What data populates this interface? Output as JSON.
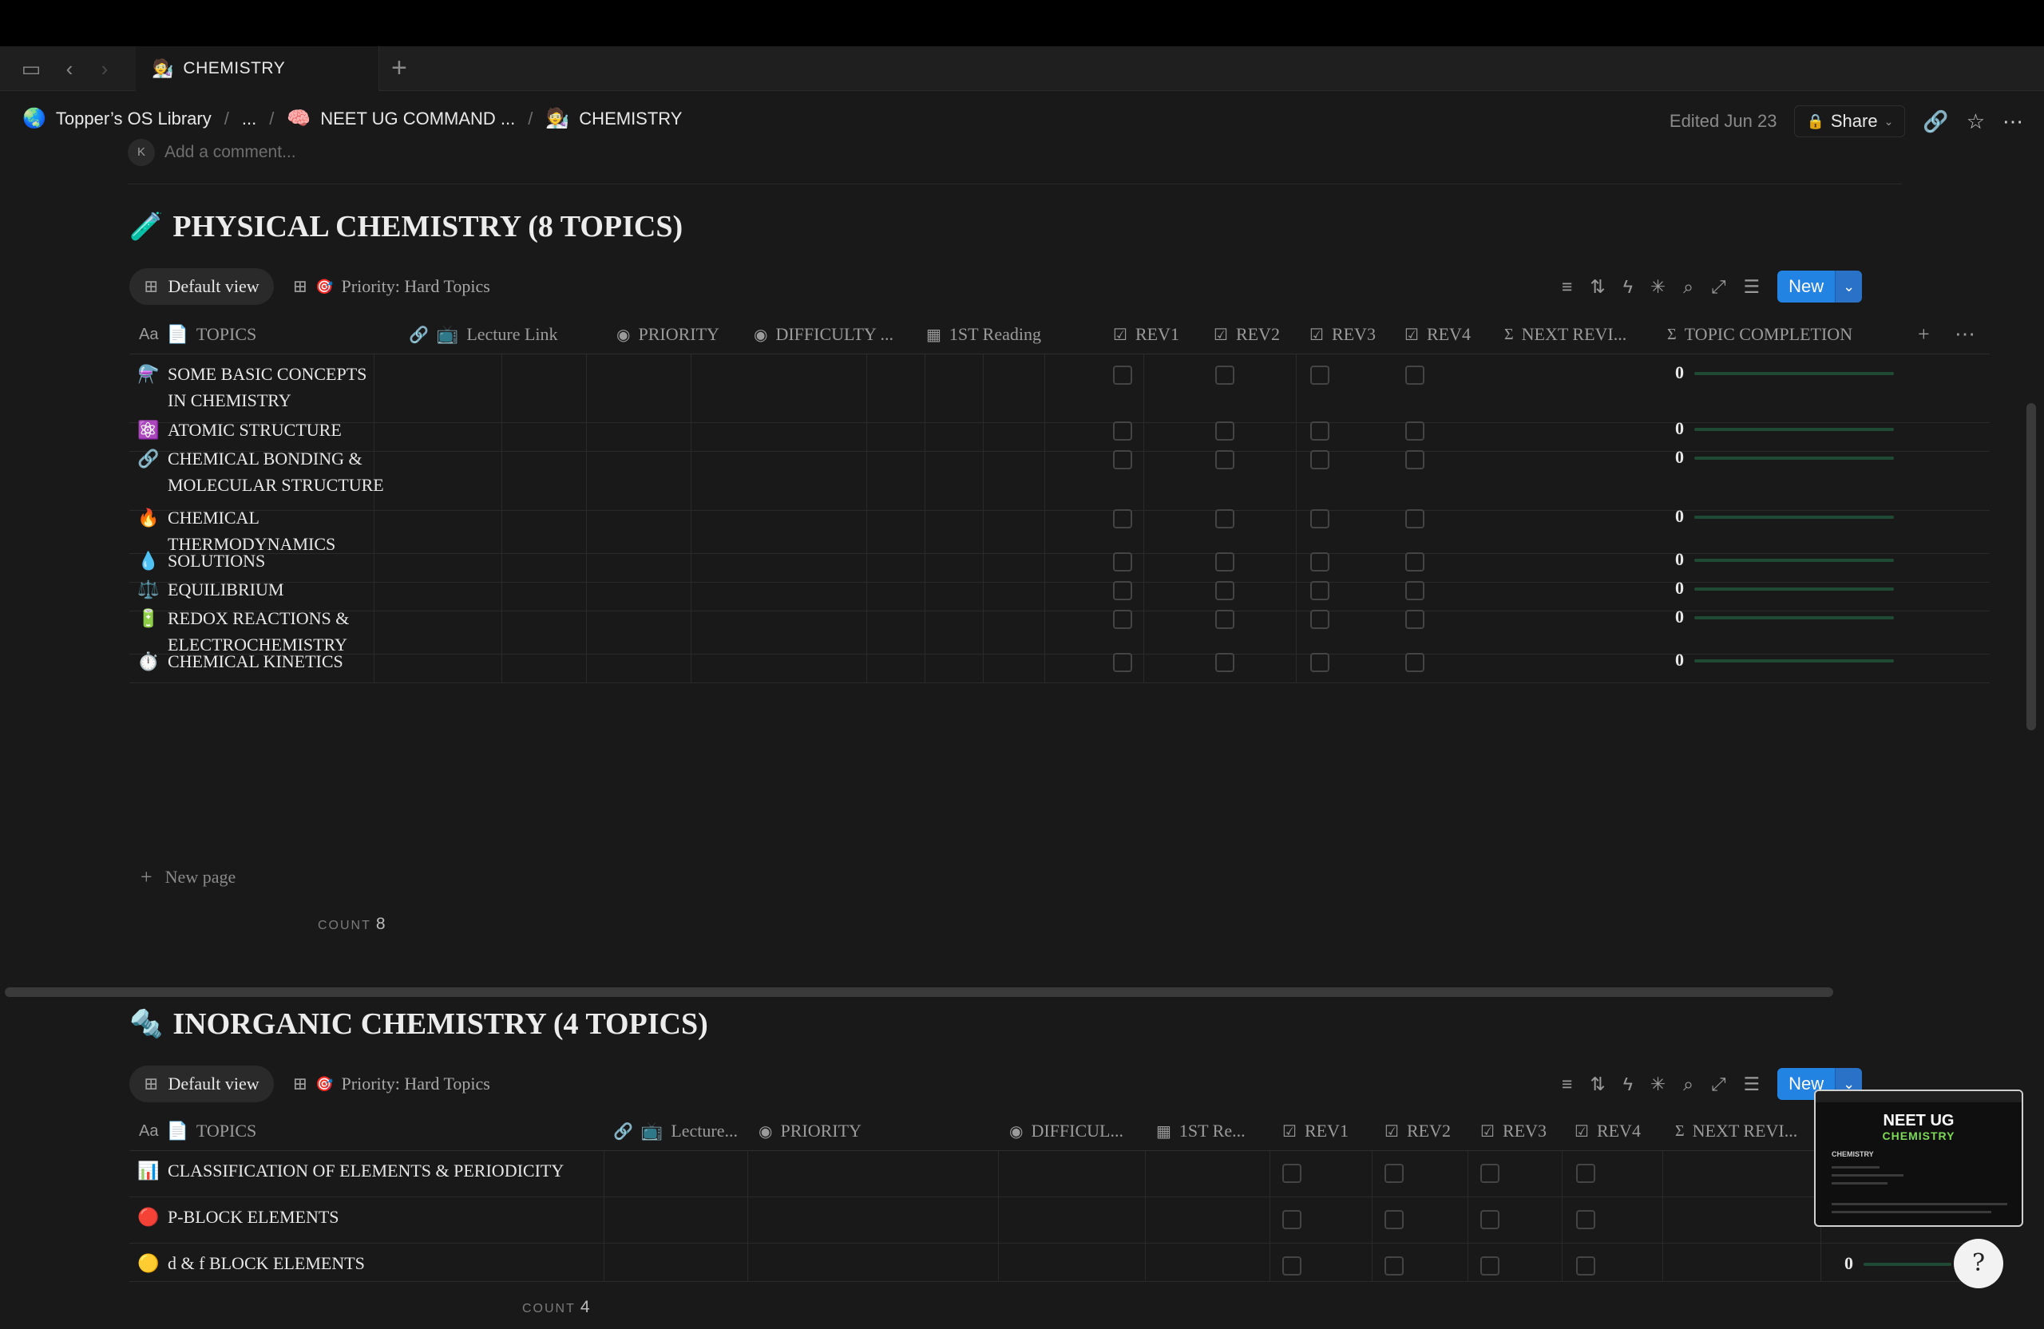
{
  "window": {
    "tab_title": "CHEMISTRY",
    "tab_icon": "scientist-emoji"
  },
  "breadcrumb": {
    "items": [
      {
        "icon": "🌏",
        "label": "Topper’s OS Library"
      },
      {
        "icon": "",
        "label": "..."
      },
      {
        "icon": "🧠",
        "label": "NEET UG COMMAND ..."
      },
      {
        "icon": "🧑‍🔬",
        "label": "CHEMISTRY"
      }
    ],
    "edited": "Edited Jun 23",
    "share_label": "Share"
  },
  "comment": {
    "avatar_letter": "K",
    "placeholder": "Add a comment..."
  },
  "physical": {
    "title_icon": "🧪",
    "title": "PHYSICAL CHEMISTRY (8 TOPICS)",
    "views": [
      "Default view",
      "Priority: Hard Topics"
    ],
    "view2_icon": "🎯",
    "new_label": "New",
    "columns": {
      "topics": "TOPICS",
      "lecture": "Lecture Link",
      "priority": "PRIORITY",
      "difficulty": "DIFFICULTY ...",
      "reading": "1ST Reading",
      "rev1": "REV1",
      "rev2": "REV2",
      "rev3": "REV3",
      "rev4": "REV4",
      "next": "NEXT REVI...",
      "completion": "TOPIC COMPLETION"
    },
    "rows": [
      {
        "icon": "⚗️",
        "name": "SOME BASIC CONCEPTS IN CHEMISTRY",
        "completion": "0"
      },
      {
        "icon": "⚛️",
        "name": "ATOMIC STRUCTURE",
        "completion": "0"
      },
      {
        "icon": "🔗",
        "name": "CHEMICAL BONDING & MOLECULAR STRUCTURE",
        "completion": "0"
      },
      {
        "icon": "🔥",
        "name": "CHEMICAL THERMODYNAMICS",
        "completion": "0"
      },
      {
        "icon": "💧",
        "name": "SOLUTIONS",
        "completion": "0"
      },
      {
        "icon": "⚖️",
        "name": "EQUILIBRIUM",
        "completion": "0"
      },
      {
        "icon": "🔋",
        "name": "REDOX REACTIONS & ELECTROCHEMISTRY",
        "completion": "0"
      },
      {
        "icon": "⏱️",
        "name": "CHEMICAL KINETICS",
        "completion": "0"
      }
    ],
    "new_page": "New page",
    "count_label": "COUNT",
    "count_value": "8"
  },
  "inorganic": {
    "title_icon": "🔩",
    "title": "INORGANIC CHEMISTRY (4 TOPICS)",
    "views": [
      "Default view",
      "Priority: Hard Topics"
    ],
    "view2_icon": "🎯",
    "new_label": "New",
    "columns": {
      "topics": "TOPICS",
      "lecture": "Lecture...",
      "priority": "PRIORITY",
      "difficulty": "DIFFICUL...",
      "reading": "1ST Re...",
      "rev1": "REV1",
      "rev2": "REV2",
      "rev3": "REV3",
      "rev4": "REV4",
      "next": "NEXT REVI..."
    },
    "rows": [
      {
        "icon": "📊",
        "name": "CLASSIFICATION OF ELEMENTS & PERIODICITY"
      },
      {
        "icon": "🔴",
        "name": "P-BLOCK ELEMENTS"
      },
      {
        "icon": "🟡",
        "name": "d & f BLOCK ELEMENTS",
        "completion": "0"
      }
    ],
    "count_label": "COUNT",
    "count_value": "4"
  },
  "thumbnail": {
    "title": "NEET UG",
    "subtitle": "CHEMISTRY",
    "caption": "CHEMISTRY"
  },
  "colors": {
    "accent": "#2383e2",
    "bg": "#191919",
    "progress": "#1f4a33"
  }
}
